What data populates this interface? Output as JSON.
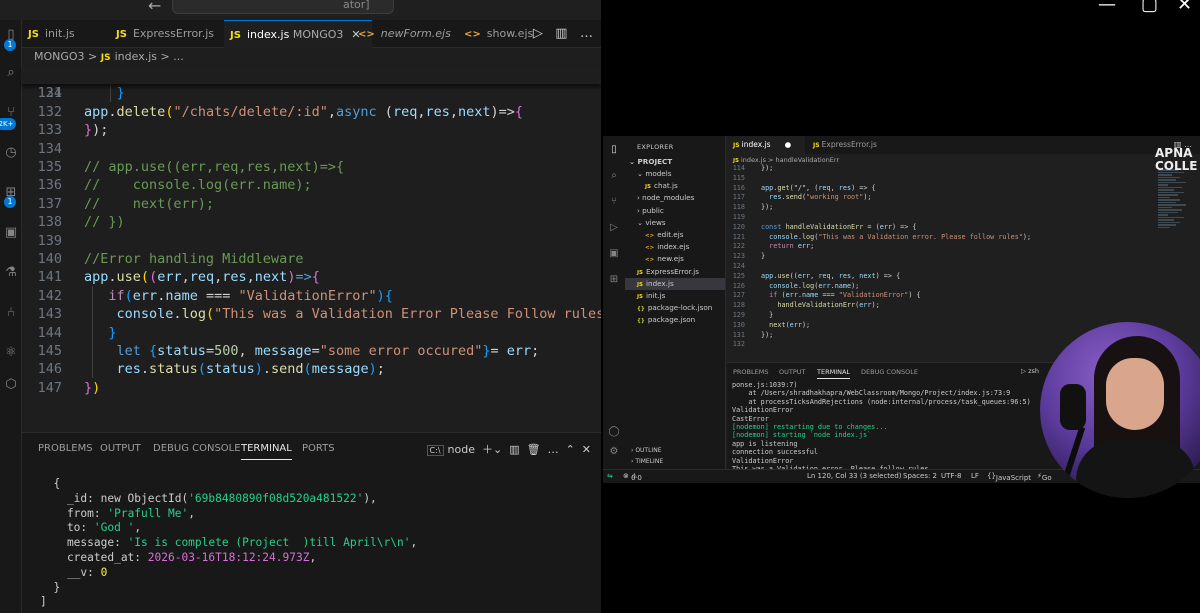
{
  "left_window": {
    "command_center_text": "ator]",
    "tabs": [
      {
        "icon": "JS",
        "label": "init.js",
        "active": false
      },
      {
        "icon": "JS",
        "label": "ExpressError.js",
        "active": false
      },
      {
        "icon": "JS",
        "label": "index.js",
        "suffix": "MONGO3",
        "active": true
      },
      {
        "icon": "<>",
        "label": "newForm.ejs",
        "active": false
      },
      {
        "icon": "<>",
        "label": "show.ejs",
        "active": false
      }
    ],
    "activity_badges": [
      "1",
      "2K+",
      "1"
    ],
    "breadcrumb": [
      "MONGO3",
      "JS",
      "index.js",
      "..."
    ],
    "code": {
      "sticky_line": {
        "num": "124",
        "tokens": [
          [
            "app",
            "var"
          ],
          [
            ".",
            "pl"
          ],
          [
            "delete",
            "fn"
          ],
          [
            "(",
            "brk"
          ],
          [
            "\"/chats/delete/:id\"",
            "str"
          ],
          [
            ",",
            "pl"
          ],
          [
            "async",
            "kw"
          ],
          [
            " (",
            "pl"
          ],
          [
            "req",
            "var"
          ],
          [
            ",",
            "pl"
          ],
          [
            "res",
            "var"
          ],
          [
            ",",
            "pl"
          ],
          [
            "next",
            "var"
          ],
          [
            ")=>",
            "pl"
          ],
          [
            "{",
            "brk2"
          ]
        ]
      },
      "lines": [
        {
          "num": "131",
          "tokens": [
            [
              "    }",
              "brk3"
            ]
          ]
        },
        {
          "num": "132",
          "tokens": []
        },
        {
          "num": "133",
          "tokens": [
            [
              "}",
              "brk2"
            ],
            [
              ");",
              "pl"
            ]
          ]
        },
        {
          "num": "134",
          "tokens": []
        },
        {
          "num": "135",
          "tokens": [
            [
              "// app.use((err,req,res,next)=>{",
              "com"
            ]
          ]
        },
        {
          "num": "136",
          "tokens": [
            [
              "//    console.log(err.name);",
              "com"
            ]
          ]
        },
        {
          "num": "137",
          "tokens": [
            [
              "//    next(err);",
              "com"
            ]
          ]
        },
        {
          "num": "138",
          "tokens": [
            [
              "// })",
              "com"
            ]
          ]
        },
        {
          "num": "139",
          "tokens": []
        },
        {
          "num": "140",
          "tokens": [
            [
              "//Error handling Middleware",
              "com"
            ]
          ]
        },
        {
          "num": "141",
          "tokens": [
            [
              "app",
              "var"
            ],
            [
              ".",
              "pl"
            ],
            [
              "use",
              "fn"
            ],
            [
              "(",
              "brk"
            ],
            [
              "(",
              "brk2"
            ],
            [
              "err",
              "var"
            ],
            [
              ",",
              "pl"
            ],
            [
              "req",
              "var"
            ],
            [
              ",",
              "pl"
            ],
            [
              "res",
              "var"
            ],
            [
              ",",
              "pl"
            ],
            [
              "next",
              "var"
            ],
            [
              ")",
              "brk2"
            ],
            [
              "=>",
              "kw"
            ],
            [
              "{",
              "brk2"
            ]
          ]
        },
        {
          "num": "142",
          "tokens": [
            [
              "   ",
              "pl"
            ],
            [
              "if",
              "ctl"
            ],
            [
              "(",
              "brk3"
            ],
            [
              "err",
              "var"
            ],
            [
              ".",
              "pl"
            ],
            [
              "name",
              "var"
            ],
            [
              " === ",
              "pl"
            ],
            [
              "\"ValidationError\"",
              "str"
            ],
            [
              ")",
              "brk3"
            ],
            [
              "{",
              "brk3"
            ]
          ]
        },
        {
          "num": "143",
          "tokens": [
            [
              "    ",
              "pl"
            ],
            [
              "console",
              "var"
            ],
            [
              ".",
              "pl"
            ],
            [
              "log",
              "fn"
            ],
            [
              "(",
              "brk"
            ],
            [
              "\"This was a Validation Error Please Follow rules\"",
              "str"
            ],
            [
              ")",
              "brk"
            ],
            [
              ";",
              "pl"
            ]
          ]
        },
        {
          "num": "144",
          "tokens": [
            [
              "   }",
              "brk3"
            ]
          ]
        },
        {
          "num": "145",
          "tokens": [
            [
              "    ",
              "pl"
            ],
            [
              "let",
              "kw"
            ],
            [
              " {",
              "brk3"
            ],
            [
              "status",
              "var"
            ],
            [
              "=",
              "pl"
            ],
            [
              "500",
              "num"
            ],
            [
              ", ",
              "pl"
            ],
            [
              "message",
              "var"
            ],
            [
              "=",
              "pl"
            ],
            [
              "\"some error occured\"",
              "str"
            ],
            [
              "}",
              "brk3"
            ],
            [
              "= ",
              "pl"
            ],
            [
              "err",
              "var"
            ],
            [
              ";",
              "pl"
            ]
          ]
        },
        {
          "num": "146",
          "tokens": [
            [
              "    ",
              "pl"
            ],
            [
              "res",
              "var"
            ],
            [
              ".",
              "pl"
            ],
            [
              "status",
              "fn"
            ],
            [
              "(",
              "brk3"
            ],
            [
              "status",
              "var"
            ],
            [
              ")",
              "brk3"
            ],
            [
              ".",
              "pl"
            ],
            [
              "send",
              "fn"
            ],
            [
              "(",
              "brk3"
            ],
            [
              "message",
              "var"
            ],
            [
              ")",
              "brk3"
            ],
            [
              ";",
              "pl"
            ]
          ]
        },
        {
          "num": "147",
          "tokens": [
            [
              "}",
              "brk2"
            ],
            [
              ")",
              "brk"
            ]
          ]
        }
      ]
    },
    "panel": {
      "tabs": [
        "PROBLEMS",
        "OUTPUT",
        "DEBUG CONSOLE",
        "TERMINAL",
        "PORTS"
      ],
      "active_tab": "TERMINAL",
      "terminal_name": "node",
      "terminal_lines": [
        [
          [
            "  {",
            "pl"
          ]
        ],
        [
          [
            "    _id: new ObjectId(",
            "pl"
          ],
          [
            "'69b8480890f08d520a481522'",
            "str"
          ],
          [
            "),",
            "pl"
          ]
        ],
        [
          [
            "    from: ",
            "pl"
          ],
          [
            "'Prafull Me'",
            "str"
          ],
          [
            ",",
            "pl"
          ]
        ],
        [
          [
            "    to: ",
            "pl"
          ],
          [
            "'God '",
            "str"
          ],
          [
            ",",
            "pl"
          ]
        ],
        [
          [
            "    message: ",
            "pl"
          ],
          [
            "'Is is complete (Project  )till April\\r\\n'",
            "str"
          ],
          [
            ",",
            "pl"
          ]
        ],
        [
          [
            "    created_at: ",
            "pl"
          ],
          [
            "2026-03-16T18:12:24.973Z",
            "date"
          ],
          [
            ",",
            "pl"
          ]
        ],
        [
          [
            "    __v: ",
            "pl"
          ],
          [
            "0",
            "num"
          ]
        ],
        [
          [
            "  }",
            "pl"
          ]
        ],
        [
          [
            "]",
            "pl"
          ]
        ]
      ]
    }
  },
  "right_video": {
    "explorer": {
      "header": "EXPLORER",
      "project": "PROJECT",
      "tree": [
        {
          "label": "models",
          "type": "folder",
          "indent": 1,
          "open": true
        },
        {
          "label": "chat.js",
          "type": "js",
          "indent": 2
        },
        {
          "label": "node_modules",
          "type": "folder",
          "indent": 1,
          "open": false
        },
        {
          "label": "public",
          "type": "folder",
          "indent": 1,
          "open": false
        },
        {
          "label": "views",
          "type": "folder",
          "indent": 1,
          "open": true
        },
        {
          "label": "edit.ejs",
          "type": "ejs",
          "indent": 2
        },
        {
          "label": "index.ejs",
          "type": "ejs",
          "indent": 2
        },
        {
          "label": "new.ejs",
          "type": "ejs",
          "indent": 2
        },
        {
          "label": "ExpressError.js",
          "type": "js",
          "indent": 1
        },
        {
          "label": "index.js",
          "type": "js",
          "indent": 1,
          "selected": true
        },
        {
          "label": "init.js",
          "type": "js",
          "indent": 1
        },
        {
          "label": "package-lock.json",
          "type": "json",
          "indent": 1
        },
        {
          "label": "package.json",
          "type": "json",
          "indent": 1
        }
      ],
      "outline": "OUTLINE",
      "timeline": "TIMELINE"
    },
    "tabs": [
      "index.js",
      "ExpressError.js"
    ],
    "breadcrumb": "index.js > handleValidationErr",
    "code": [
      {
        "num": "114",
        "tokens": [
          [
            "});",
            "pl"
          ]
        ]
      },
      {
        "num": "115",
        "tokens": []
      },
      {
        "num": "116",
        "tokens": [
          [
            "app",
            "var"
          ],
          [
            ".",
            "pl"
          ],
          [
            "get",
            "fn"
          ],
          [
            "(\"/\", (",
            "pl"
          ],
          [
            "req",
            "var"
          ],
          [
            ", ",
            "pl"
          ],
          [
            "res",
            "var"
          ],
          [
            ") => {",
            "pl"
          ]
        ]
      },
      {
        "num": "117",
        "tokens": [
          [
            "  res",
            "var"
          ],
          [
            ".",
            "pl"
          ],
          [
            "send",
            "fn"
          ],
          [
            "(",
            "pl"
          ],
          [
            "\"working root\"",
            "str"
          ],
          [
            ");",
            "pl"
          ]
        ]
      },
      {
        "num": "118",
        "tokens": [
          [
            "});",
            "pl"
          ]
        ]
      },
      {
        "num": "119",
        "tokens": []
      },
      {
        "num": "120",
        "tokens": [
          [
            "const ",
            "kw"
          ],
          [
            "handleValidationErr",
            "fn"
          ],
          [
            " = (",
            "pl"
          ],
          [
            "err",
            "var"
          ],
          [
            ") => {",
            "pl"
          ]
        ]
      },
      {
        "num": "121",
        "tokens": [
          [
            "  console",
            "var"
          ],
          [
            ".",
            "pl"
          ],
          [
            "log",
            "fn"
          ],
          [
            "(",
            "pl"
          ],
          [
            "\"This was a Validation error. Please follow rules\"",
            "str"
          ],
          [
            ");",
            "pl"
          ]
        ]
      },
      {
        "num": "122",
        "tokens": [
          [
            "  return ",
            "ctl"
          ],
          [
            "err",
            "var"
          ],
          [
            ";",
            "pl"
          ]
        ]
      },
      {
        "num": "123",
        "tokens": [
          [
            "}",
            "pl"
          ]
        ]
      },
      {
        "num": "124",
        "tokens": []
      },
      {
        "num": "125",
        "tokens": [
          [
            "app",
            "var"
          ],
          [
            ".",
            "pl"
          ],
          [
            "use",
            "fn"
          ],
          [
            "((",
            "pl"
          ],
          [
            "err",
            "var"
          ],
          [
            ", ",
            "pl"
          ],
          [
            "req",
            "var"
          ],
          [
            ", ",
            "pl"
          ],
          [
            "res",
            "var"
          ],
          [
            ", ",
            "pl"
          ],
          [
            "next",
            "var"
          ],
          [
            ") => {",
            "pl"
          ]
        ]
      },
      {
        "num": "126",
        "tokens": [
          [
            "  console",
            "var"
          ],
          [
            ".",
            "pl"
          ],
          [
            "log",
            "fn"
          ],
          [
            "(",
            "pl"
          ],
          [
            "err",
            "var"
          ],
          [
            ".",
            "pl"
          ],
          [
            "name",
            "var"
          ],
          [
            ");",
            "pl"
          ]
        ]
      },
      {
        "num": "127",
        "tokens": [
          [
            "  if ",
            "ctl"
          ],
          [
            "(",
            "pl"
          ],
          [
            "err",
            "var"
          ],
          [
            ".",
            "pl"
          ],
          [
            "name",
            "var"
          ],
          [
            " === ",
            "pl"
          ],
          [
            "\"ValidationError\"",
            "str"
          ],
          [
            ") {",
            "pl"
          ]
        ]
      },
      {
        "num": "128",
        "tokens": [
          [
            "    handleValidationErr",
            "fn"
          ],
          [
            "(",
            "pl"
          ],
          [
            "err",
            "var"
          ],
          [
            ");",
            "pl"
          ]
        ]
      },
      {
        "num": "129",
        "tokens": [
          [
            "  }",
            "pl"
          ]
        ]
      },
      {
        "num": "130",
        "tokens": [
          [
            "  next",
            "fn"
          ],
          [
            "(",
            "pl"
          ],
          [
            "err",
            "var"
          ],
          [
            ");",
            "pl"
          ]
        ]
      },
      {
        "num": "131",
        "tokens": [
          [
            "});",
            "pl"
          ]
        ]
      },
      {
        "num": "132",
        "tokens": []
      }
    ],
    "panel_tabs": [
      "PROBLEMS",
      "OUTPUT",
      "TERMINAL",
      "DEBUG CONSOLE"
    ],
    "panel_active": "TERMINAL",
    "terminal_shell": "zsh",
    "terminal_lines": [
      {
        "text": "ponse.js:1039:7)",
        "green": false
      },
      {
        "text": "    at /Users/shradhakhapra/WebClassroom/Mongo/Project/index.js:73:9",
        "green": false
      },
      {
        "text": "    at processTicksAndRejections (node:internal/process/task_queues:96:5)",
        "green": false
      },
      {
        "text": "ValidationError",
        "green": false
      },
      {
        "text": "CastError",
        "green": false
      },
      {
        "text": "[nodemon] restarting due to changes...",
        "green": true
      },
      {
        "text": "[nodemon] starting `node index.js`",
        "green": true
      },
      {
        "text": "app is listening",
        "green": false
      },
      {
        "text": "connection successful",
        "green": false
      },
      {
        "text": "ValidationError",
        "green": false
      },
      {
        "text": "This was a Validation error. Please follow rules",
        "green": false
      }
    ],
    "status": {
      "errors": "0",
      "warnings": "0",
      "position": "Ln 120, Col 33 (3 selected)",
      "spaces": "Spaces: 2",
      "encoding": "UTF-8",
      "eol": "LF",
      "language": "JavaScript",
      "golive": "Go"
    },
    "brand": [
      "APNA",
      "COLLE"
    ]
  },
  "colors": {
    "js_icon": "#f5de19",
    "accent": "#0078d4",
    "string": "#ce9178",
    "comment": "#6a9955",
    "terminal_green": "#23d18b"
  }
}
